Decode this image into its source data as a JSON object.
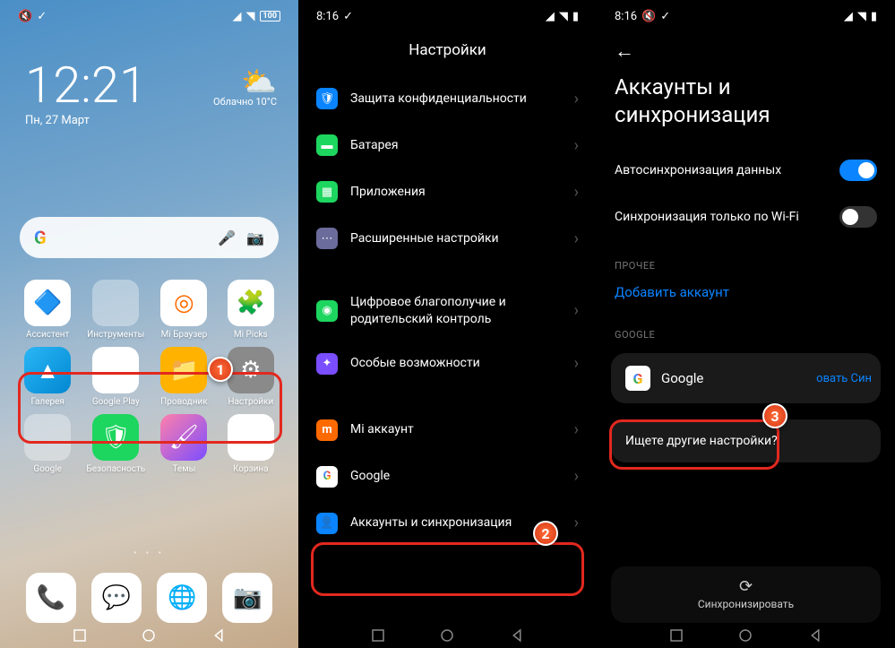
{
  "p1": {
    "status_time": "",
    "battery": "100",
    "clock": "12:21",
    "date": "Пн, 27 Март",
    "weather_cond": "Облачно",
    "weather_temp": "10°C",
    "apps_r1": [
      {
        "label": "Ассистент",
        "bg": "#ffffff",
        "emoji": "💠"
      },
      {
        "label": "Инструменты",
        "bg": "folder"
      },
      {
        "label": "Mi Браузер",
        "bg": "#ffffff",
        "emoji": "🌐"
      },
      {
        "label": "Mi Picks",
        "bg": "#ffffff",
        "emoji": "🧩"
      }
    ],
    "apps_r2": [
      {
        "label": "Галерея",
        "bg": "#2db4ff",
        "emoji": "🖼"
      },
      {
        "label": "Google Play",
        "bg": "#ffffff",
        "emoji": "▶"
      },
      {
        "label": "Проводник",
        "bg": "#ffb300",
        "emoji": "📁"
      },
      {
        "label": "Настройки",
        "bg": "#8a8a8a",
        "emoji": "⚙"
      }
    ],
    "apps_r3": [
      {
        "label": "Google",
        "bg": "folder"
      },
      {
        "label": "Безопасность",
        "bg": "#1dd65f",
        "emoji": "🛡"
      },
      {
        "label": "Темы",
        "bg": "#ffffff",
        "emoji": "🖌"
      },
      {
        "label": "Корзина",
        "bg": "#ffffff",
        "emoji": "🗑"
      }
    ],
    "dock": [
      {
        "bg": "#ffffff",
        "emoji": "📞"
      },
      {
        "bg": "#ffffff",
        "emoji": "💬"
      },
      {
        "bg": "#ffffff",
        "emoji": "🌐"
      },
      {
        "bg": "#ffffff",
        "emoji": "📷"
      }
    ]
  },
  "p2": {
    "time": "8:16",
    "battery": "",
    "title": "Настройки",
    "items": [
      {
        "label": "Защита конфиденциальности",
        "bg": "#0a84ff",
        "glyph": "🔒"
      },
      {
        "label": "Батарея",
        "bg": "#1dd65f",
        "glyph": "▬"
      },
      {
        "label": "Приложения",
        "bg": "#1dd65f",
        "glyph": "◧"
      },
      {
        "label": "Расширенные настройки",
        "bg": "#6b6b9c",
        "glyph": "⋯"
      }
    ],
    "items2": [
      {
        "label": "Цифровое благополучие и родительский контроль",
        "bg": "#1dd65f",
        "glyph": "◉"
      },
      {
        "label": "Особые возможности",
        "bg": "#7a4dff",
        "glyph": "✦"
      }
    ],
    "items3": [
      {
        "label": "Mi аккаунт",
        "bg": "#ff6a00",
        "glyph": "m"
      },
      {
        "label": "Google",
        "bg": "#ffffff",
        "glyph": "G"
      },
      {
        "label": "Аккаунты и синхронизация",
        "bg": "#0a84ff",
        "glyph": "👤"
      }
    ]
  },
  "p3": {
    "time": "8:16",
    "title": "Аккаунты и синхронизация",
    "autosync": "Автосинхронизация данных",
    "wifi_only": "Синхронизация только по Wi-Fi",
    "section_other": "ПРОЧЕЕ",
    "add_account": "Добавить аккаунт",
    "section_google": "GOOGLE",
    "google_label": "Google",
    "hidden_actions": "овать    Син",
    "other_settings": "Ищете другие настройки?",
    "sync_btn": "Синхронизировать"
  },
  "steps": {
    "s1": "1",
    "s2": "2",
    "s3": "3"
  }
}
